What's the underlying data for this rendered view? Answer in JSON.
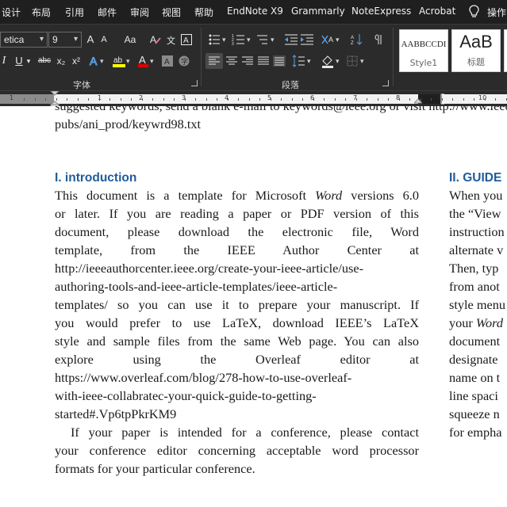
{
  "menubar": {
    "tabs": [
      "设计",
      "布局",
      "引用",
      "邮件",
      "审阅",
      "视图",
      "帮助",
      "EndNote X9",
      "Grammarly",
      "NoteExpress",
      "Acrobat"
    ],
    "tell_me": "操作"
  },
  "ribbon": {
    "font_name": "etica",
    "font_size": "9",
    "grow_font": "A",
    "shrink_font": "A",
    "change_case": "Aa",
    "bold": "I",
    "underline": "U",
    "strikethrough": "abc",
    "subscript": "x₂",
    "superscript": "x²",
    "font_group_label": "字体",
    "paragraph_group_label": "段落",
    "styles": [
      {
        "sample": "AABBCCDI",
        "name": "Style1"
      },
      {
        "sample": "AaB",
        "name": "标题"
      }
    ],
    "colors": {
      "highlight": "#ffff00",
      "font_color": "#e00000",
      "accent": "#1f5c99"
    }
  },
  "ruler": {
    "numbers": [
      "1",
      "1",
      "2",
      "3",
      "4",
      "5",
      "6",
      "7",
      "8",
      "9",
      "10"
    ]
  },
  "document": {
    "top_line_partial": "suggested keywords, send a blank e-mail to keywords@ieee.org or visit http://www.ieee.org/organizations/",
    "top_line": "pubs/ani_prod/keywrd98.txt",
    "section1_heading": "I.  introduction",
    "section1_lines": [
      "This document is a template for Microsoft",
      "Word",
      "versions 6.0",
      "or later. If you are reading a paper or PDF version of this",
      "document, please download the electronic file, Word",
      "template, from the IEEE Author Center at",
      "http://ieeeauthorcenter.ieee.org/create-your-ieee-article/use-",
      "authoring-tools-and-ieee-article-templates/ieee-article-",
      "templates/ so you can use it to prepare your manuscript. If",
      "you would prefer to use LaTeX, download IEEE’s LaTeX",
      "style and sample files from the same Web page. You can also",
      "explore using the Overleaf editor at",
      "https://www.overleaf.com/blog/278-how-to-use-overleaf-",
      "with-ieee-collabratec-your-quick-guide-to-getting-",
      "started#.Vp6tpPkrKM9"
    ],
    "section1_para2": [
      "If your paper is intended for a conference, please contact",
      "your conference editor concerning acceptable word processor",
      "formats for your particular conference."
    ],
    "section2_heading": "II.  GUIDE",
    "section2_lines": [
      "When you",
      "the “View",
      "instruction",
      "alternate v",
      "Then, typ",
      "from anot",
      "style menu",
      "your",
      "Word",
      "document",
      "designate",
      "name on t",
      "line spaci",
      "squeeze n",
      "for empha"
    ]
  }
}
